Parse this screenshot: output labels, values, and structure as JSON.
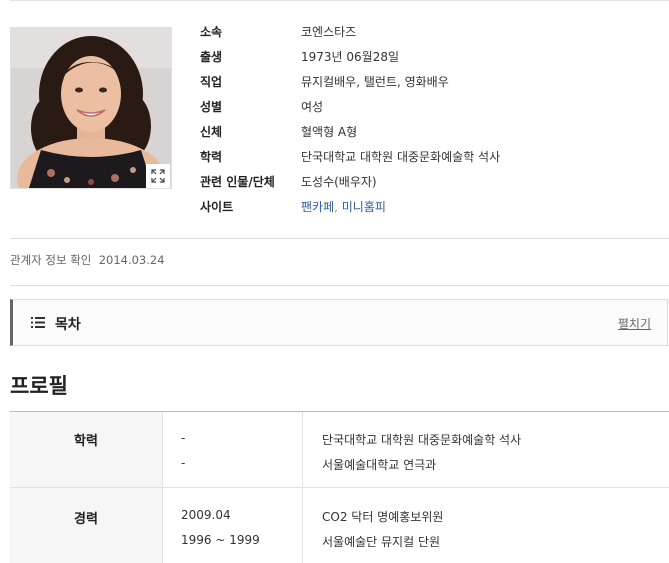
{
  "profile": {
    "photo": {
      "alt": "프로필 사진",
      "expand_icon": "expand-icon"
    },
    "info": [
      {
        "label": "소속",
        "value": "코엔스타즈"
      },
      {
        "label": "출생",
        "value": "1973년 06월28일"
      },
      {
        "label": "직업",
        "value": "뮤지컬배우, 탤런트, 영화배우"
      },
      {
        "label": "성별",
        "value": "여성"
      },
      {
        "label": "신체",
        "value": "혈액형 A형"
      },
      {
        "label": "학력",
        "value": "단국대학교 대학원 대중문화예술학 석사"
      },
      {
        "label": "관련 인물/단체",
        "value": "도성수(배우자)"
      },
      {
        "label": "사이트",
        "links": [
          "팬카페",
          "미니홈피"
        ],
        "separator": ", "
      }
    ]
  },
  "confirm": {
    "label": "관계자 정보 확인",
    "date": "2014.03.24"
  },
  "toc": {
    "icon": "list-icon",
    "title": "목차",
    "toggle": "펼치기"
  },
  "section": {
    "title": "프로필"
  },
  "table": {
    "rows": [
      {
        "category": "학력",
        "entries": [
          {
            "date": "-",
            "desc": "단국대학교 대학원 대중문화예술학 석사"
          },
          {
            "date": "-",
            "desc": "서울예술대학교 연극과"
          }
        ]
      },
      {
        "category": "경력",
        "entries": [
          {
            "date": "2009.04",
            "desc": "CO2 닥터 명예홍보위원"
          },
          {
            "date": "1996 ~ 1999",
            "desc": "서울예술단 뮤지컬 단원"
          }
        ]
      }
    ]
  },
  "colors": {
    "link": "#2f5c9e",
    "toc_accent": "#666666",
    "category_bg": "#f6f6f6"
  }
}
